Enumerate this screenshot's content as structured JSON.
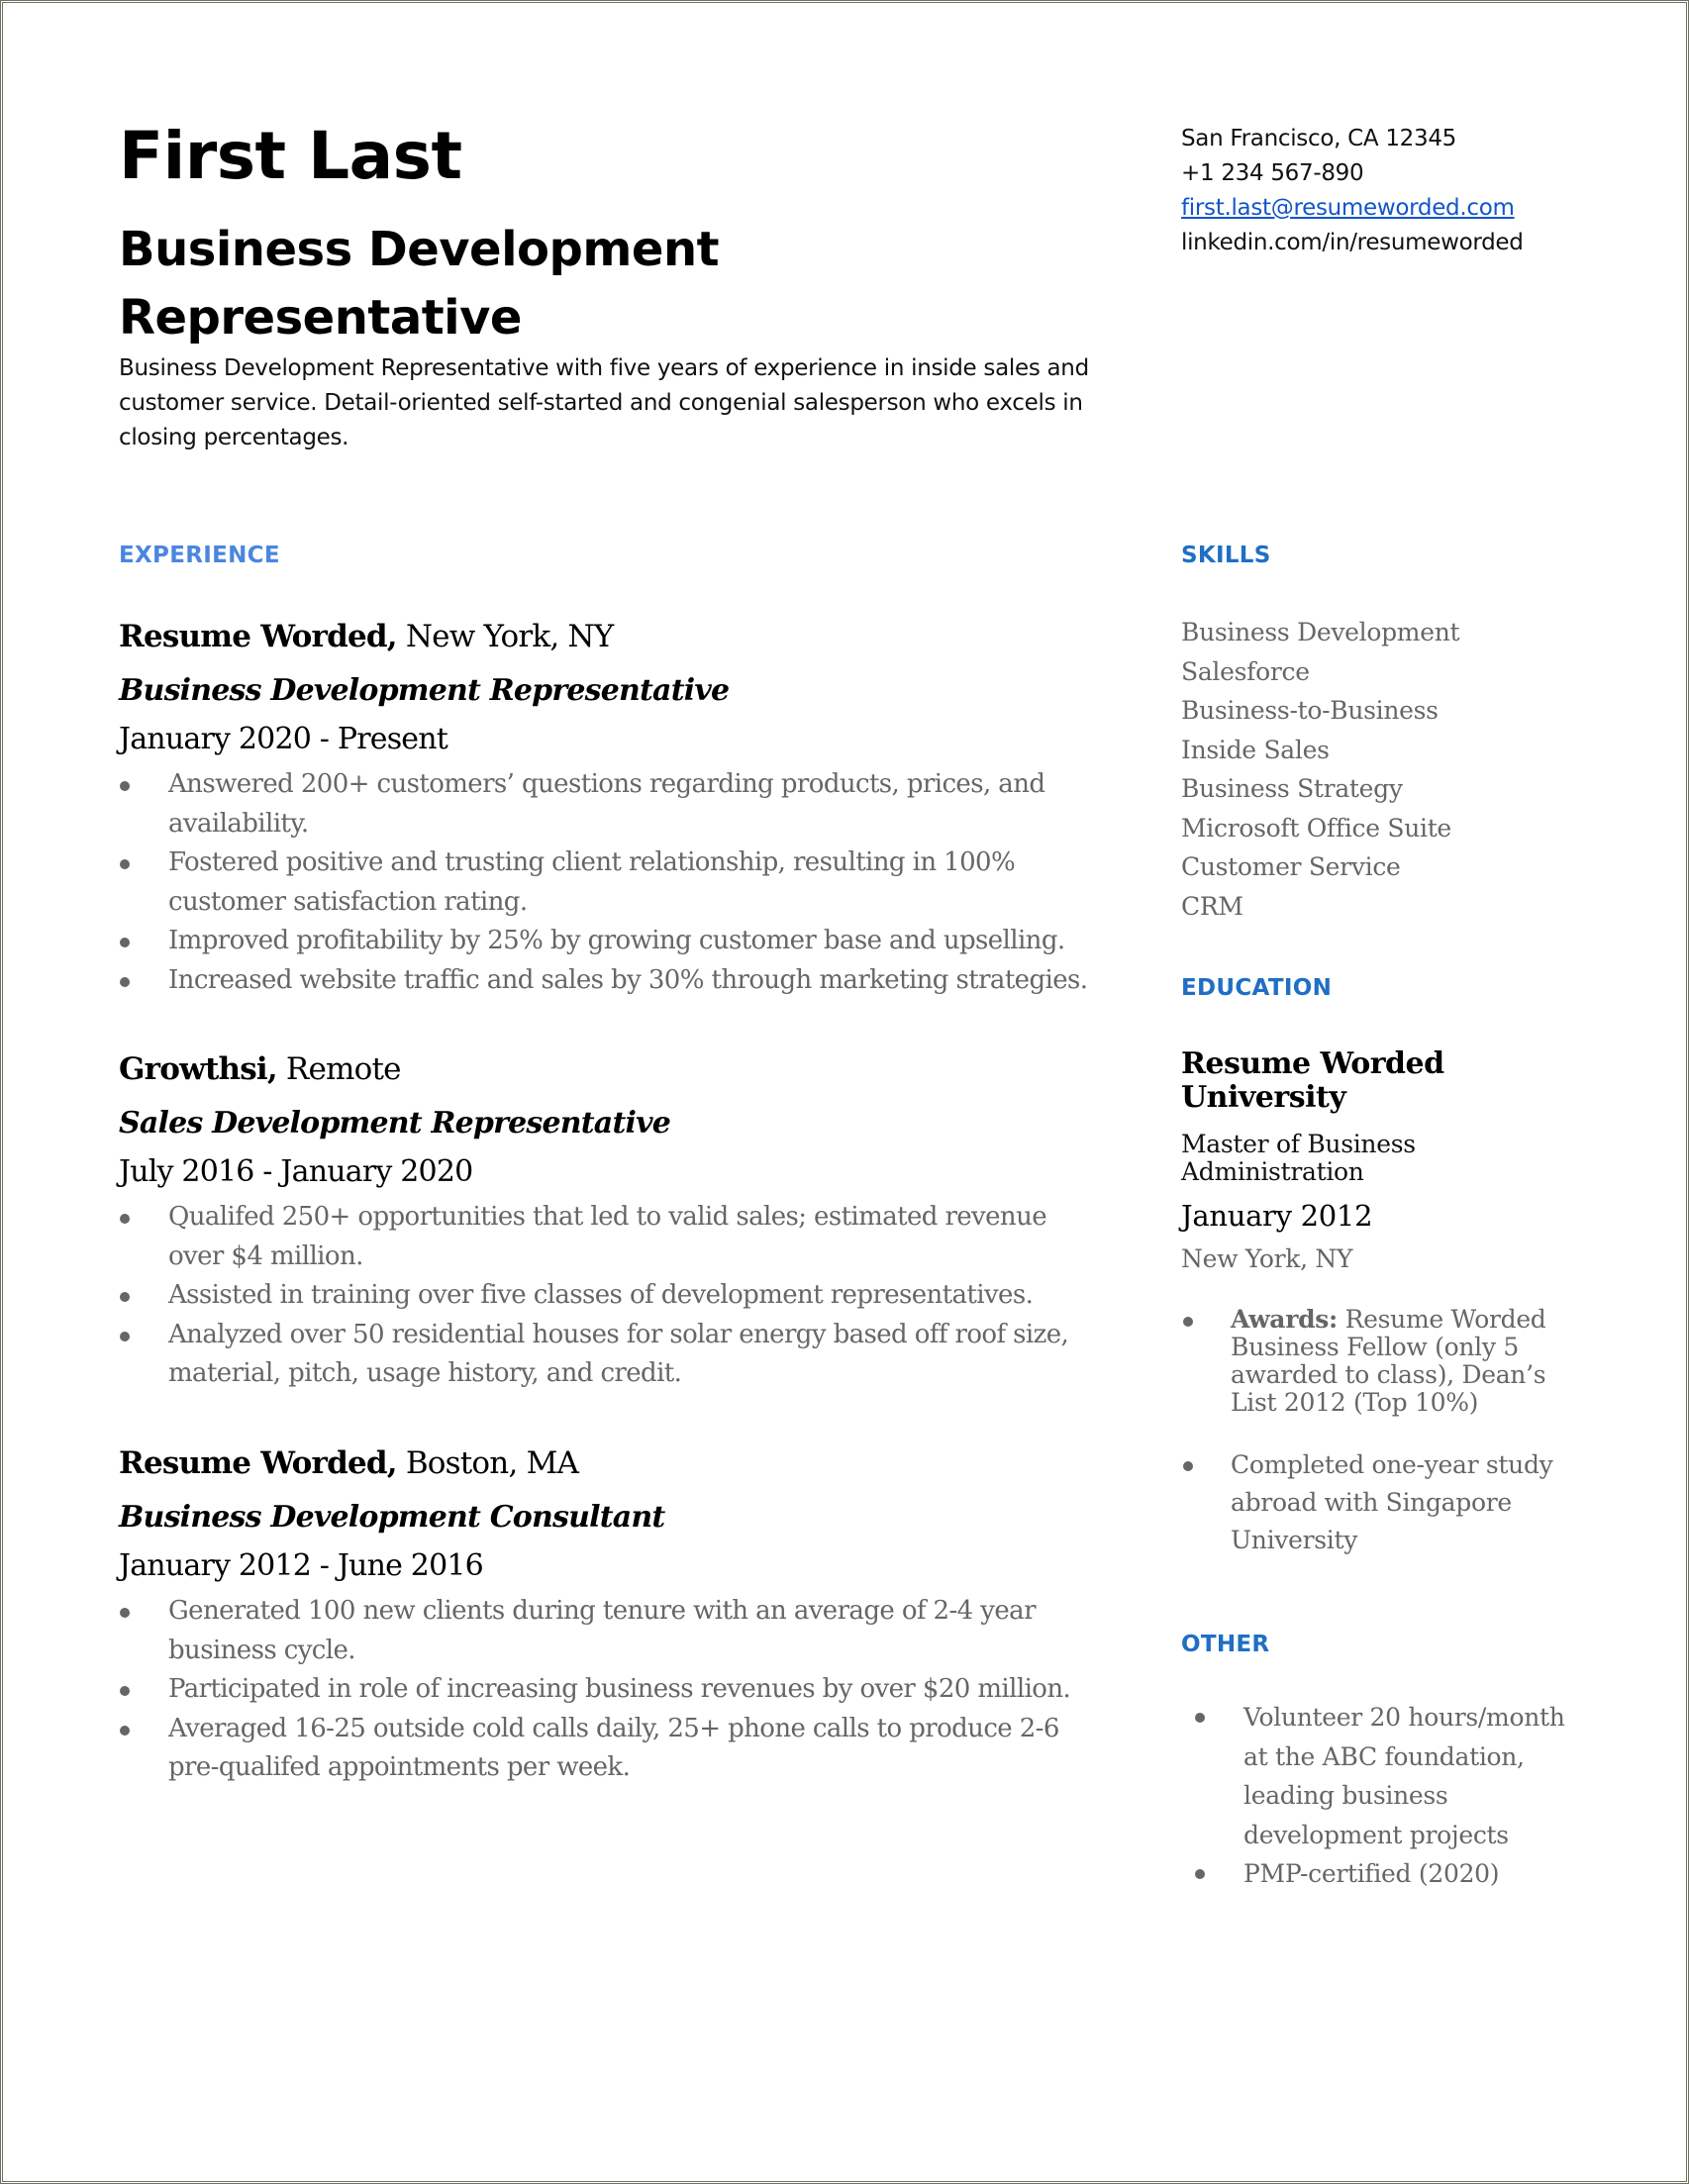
{
  "header": {
    "name": "First Last",
    "headline": "Business Development Representative",
    "summary": "Business Development Representative with five years of experience in inside sales and customer service. Detail-oriented self-started and congenial salesperson who excels in closing percentages."
  },
  "contact": {
    "location": "San Francisco, CA 12345",
    "phone": "+1 234 567-890",
    "email": "first.last@resumeworded.com",
    "linkedin": "linkedin.com/in/resumeworded"
  },
  "colors": {
    "experience_heading": "#4a86e0",
    "sidebar_heading": "#1f6fc4",
    "link": "#1155cc",
    "muted_text": "#666666"
  },
  "experience": {
    "heading": "EXPERIENCE",
    "jobs": [
      {
        "company": "Resume Worded,",
        "location": " New York, NY",
        "title": "Business Development Representative",
        "dates": "January 2020 - Present",
        "bullets": [
          "Answered 200+ customers’ questions regarding products, prices, and availability.",
          "Fostered positive and trusting client relationship, resulting in 100% customer satisfaction rating.",
          "Improved profitability by 25% by growing customer base and upselling.",
          "Increased website traffic and sales by 30% through marketing strategies."
        ]
      },
      {
        "company": "Growthsi,",
        "location": " Remote",
        "title": "Sales Development Representative",
        "dates": "July 2016 - January 2020",
        "bullets": [
          "Qualifed 250+ opportunities that led to valid sales; estimated revenue over $4 million.",
          "Assisted in training over five classes of development representatives.",
          "Analyzed over 50 residential houses for solar energy based off roof size, material, pitch, usage history, and credit."
        ]
      },
      {
        "company": "Resume Worded,",
        "location": " Boston, MA",
        "title": "Business Development Consultant",
        "dates": "January 2012 - June 2016",
        "bullets": [
          "Generated 100 new clients during tenure with an average of 2-4 year business cycle.",
          "Participated in role of increasing business revenues by over $20 million.",
          "Averaged 16-25 outside cold calls daily, 25+ phone calls to produce 2-6 pre-qualifed appointments per week."
        ]
      }
    ]
  },
  "skills": {
    "heading": "SKILLS",
    "items": [
      "Business Development",
      "Salesforce",
      "Business-to-Business",
      "Inside Sales",
      "Business Strategy",
      "Microsoft Office Suite",
      "Customer Service",
      "CRM"
    ]
  },
  "education": {
    "heading": "EDUCATION",
    "school": "Resume Worded University",
    "degree": "Master of Business Administration",
    "date": "January 2012",
    "location": "New York, NY",
    "bullets": [
      {
        "label": "Awards:",
        "text": " Resume Worded Business Fellow (only 5 awarded to class), Dean’s List 2012 (Top 10%)"
      },
      {
        "label": "",
        "text": "Completed one-year study abroad with Singapore University"
      }
    ]
  },
  "other": {
    "heading": "OTHER",
    "items": [
      "Volunteer 20 hours/month at the ABC foundation, leading business development projects",
      "PMP-certified (2020)"
    ]
  }
}
